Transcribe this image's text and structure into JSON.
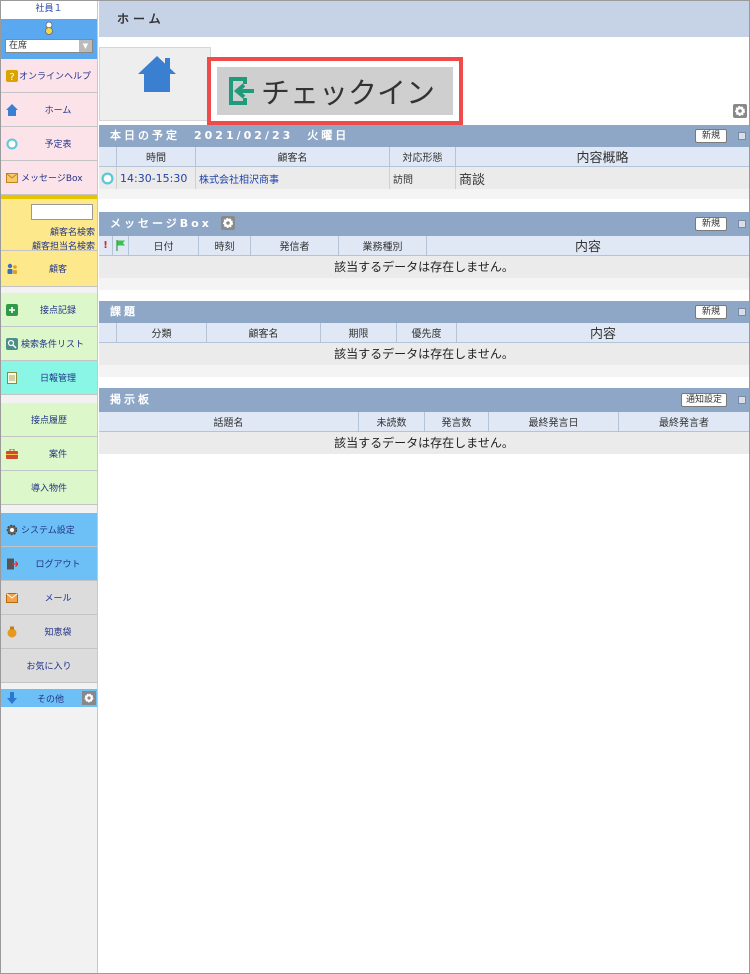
{
  "sidebar": {
    "user_name": "社員１",
    "status_value": "在席",
    "items": {
      "help": "オンラインヘルプ",
      "home": "ホーム",
      "schedule": "予定表",
      "message_box": "メッセージBox",
      "customer_search": "顧客名検索",
      "customer_contact_search": "顧客担当名検索",
      "customer": "顧客",
      "contact_record": "接点記録",
      "search_list": "検索条件リスト",
      "daily_report": "日報管理",
      "contact_history": "接点履歴",
      "deals": "案件",
      "installed_items": "導入物件",
      "system_settings": "システム設定",
      "logout": "ログアウト",
      "mail": "メール",
      "knowledge": "知恵袋",
      "favorites": "お気に入り",
      "others": "その他"
    }
  },
  "header": {
    "title": "ホーム"
  },
  "checkin": {
    "label": "チェックイン"
  },
  "today": {
    "title": "本日の予定　2021/02/23　火曜日",
    "new_button": "新規",
    "columns": [
      "時間",
      "顧客名",
      "対応形態",
      "内容概略"
    ],
    "rows": [
      {
        "time": "14:30-15:30",
        "customer": "株式会社相沢商事",
        "type": "訪問",
        "summary": "商談"
      }
    ]
  },
  "messages": {
    "title": "メッセージBox",
    "new_button": "新規",
    "columns": [
      "!",
      "",
      "日付",
      "時刻",
      "発信者",
      "業務種別",
      "内容"
    ],
    "empty": "該当するデータは存在しません。"
  },
  "tasks": {
    "title": "課題",
    "new_button": "新規",
    "columns": [
      "分類",
      "顧客名",
      "期限",
      "優先度",
      "内容"
    ],
    "empty": "該当するデータは存在しません。"
  },
  "board": {
    "title": "掲示板",
    "notify_button": "通知設定",
    "columns": [
      "話題名",
      "未読数",
      "発言数",
      "最終発言日",
      "最終発言者"
    ],
    "empty": "該当するデータは存在しません。"
  },
  "colors": {
    "accent_red": "#ef4b4b",
    "section_header": "#8ea7c6",
    "topbar": "#c6d3e6",
    "home_icon": "#3a7fd0",
    "checkin_icon": "#1f9a7a"
  }
}
